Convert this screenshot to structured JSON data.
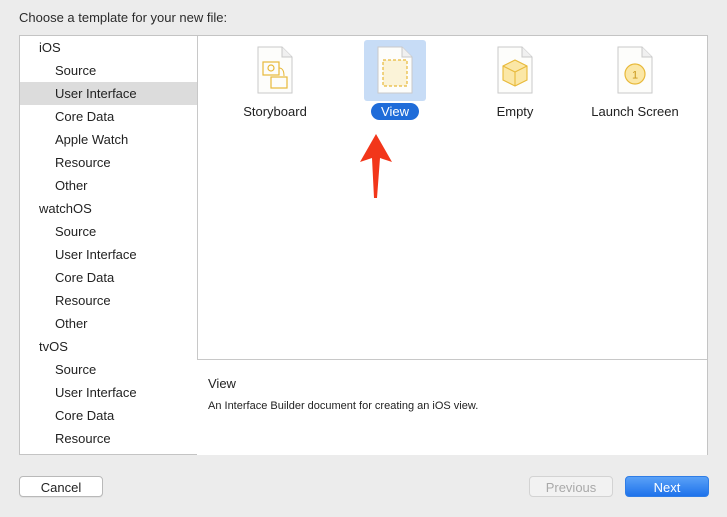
{
  "dialog": {
    "title": "Choose a template for your new file:"
  },
  "sidebar": {
    "groups": [
      {
        "label": "iOS",
        "items": [
          "Source",
          "User Interface",
          "Core Data",
          "Apple Watch",
          "Resource",
          "Other"
        ]
      },
      {
        "label": "watchOS",
        "items": [
          "Source",
          "User Interface",
          "Core Data",
          "Resource",
          "Other"
        ]
      },
      {
        "label": "tvOS",
        "items": [
          "Source",
          "User Interface",
          "Core Data",
          "Resource"
        ]
      }
    ],
    "selected": "iOS / User Interface"
  },
  "templates": {
    "items": [
      {
        "label": "Storyboard",
        "icon": "storyboard-icon"
      },
      {
        "label": "View",
        "icon": "view-icon",
        "selected": true
      },
      {
        "label": "Empty",
        "icon": "empty-icon"
      },
      {
        "label": "Launch Screen",
        "icon": "launch-screen-icon"
      }
    ]
  },
  "description": {
    "name": "View",
    "text": "An Interface Builder document for creating an iOS view."
  },
  "buttons": {
    "cancel": "Cancel",
    "previous": "Previous",
    "next": "Next"
  },
  "colors": {
    "accent": "#1f6cd9",
    "selection_bg": "#c7dcf6",
    "icon_gold": "#e8b93a",
    "annotation_arrow": "#f2361a"
  }
}
